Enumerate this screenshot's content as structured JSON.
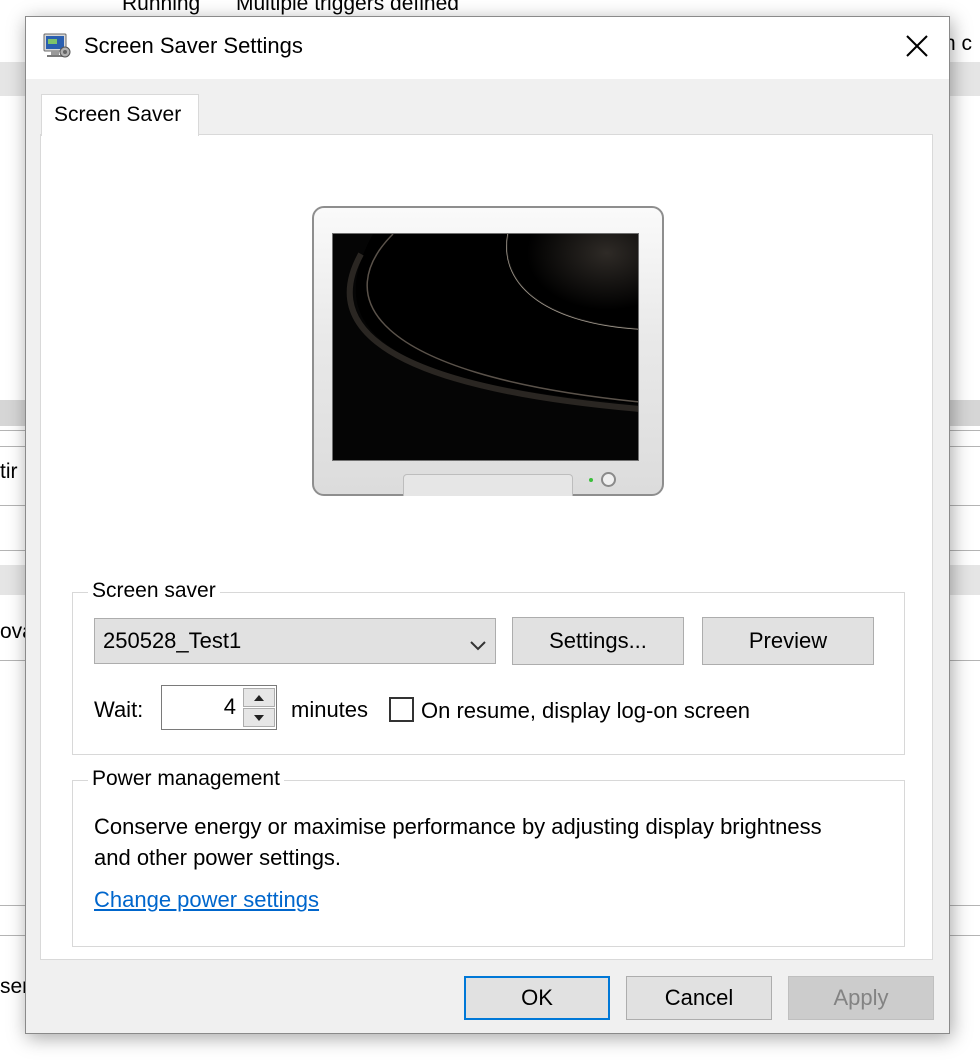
{
  "background": {
    "row_status": "Running",
    "row_triggers": "Multiple triggers defined",
    "fragment_right": "n c",
    "fragment_left_1": "tir",
    "fragment_left_2": "ova",
    "fragment_left_3": "ser"
  },
  "dialog": {
    "title": "Screen Saver Settings",
    "title_icon": "monitor-settings-icon",
    "close_icon": "close-icon",
    "tab_label": "Screen Saver"
  },
  "screen_saver": {
    "group_label": "Screen saver",
    "selected": "250528_Test1",
    "settings_button": "Settings...",
    "preview_button": "Preview",
    "wait_label": "Wait:",
    "wait_value": "4",
    "minutes_label": "minutes",
    "resume_checked": false,
    "resume_label": "On resume, display log-on screen"
  },
  "power": {
    "group_label": "Power management",
    "description": "Conserve energy or maximise performance by adjusting display brightness and other power settings.",
    "link": "Change power settings"
  },
  "buttons": {
    "ok": "OK",
    "cancel": "Cancel",
    "apply": "Apply",
    "apply_enabled": false
  },
  "colors": {
    "dialog_bg": "#f0f0f0",
    "accent": "#0078d7",
    "link": "#0066cc"
  }
}
